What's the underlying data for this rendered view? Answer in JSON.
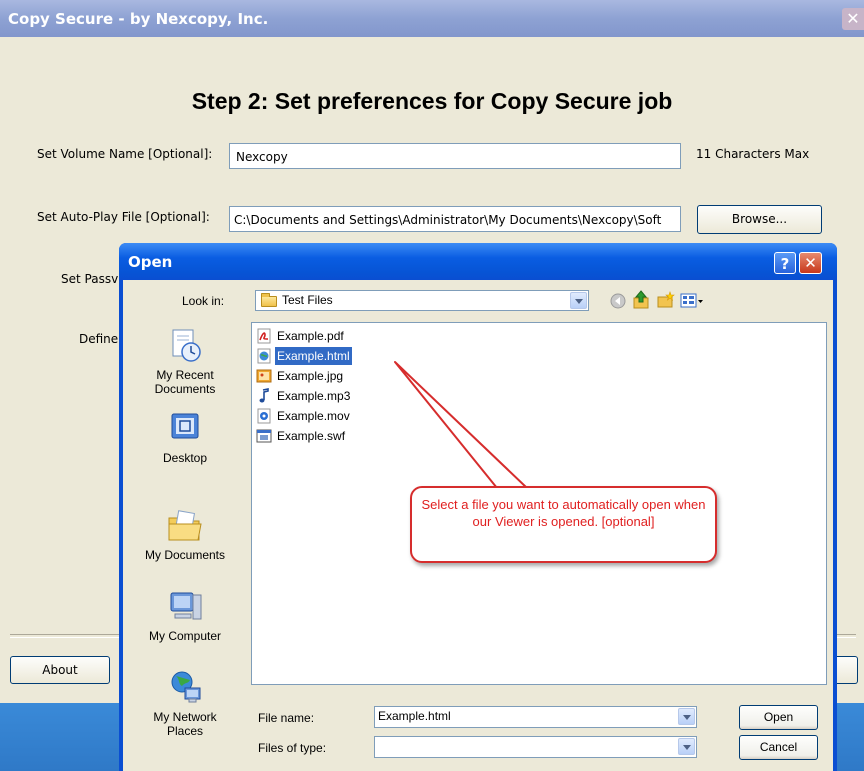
{
  "main_window": {
    "title": "Copy Secure - by Nexcopy, Inc.",
    "close_icon": "close-icon",
    "heading": "Step 2: Set preferences for Copy Secure job",
    "volume_name": {
      "label": "Set Volume Name [Optional]:",
      "value": "Nexcopy",
      "hint": "11 Characters Max"
    },
    "autoplay": {
      "label": "Set Auto-Play File [Optional]:",
      "value": "C:\\Documents and Settings\\Administrator\\My Documents\\Nexcopy\\Soft",
      "browse_label": "Browse..."
    },
    "password": {
      "label_partial": "Set Passv"
    },
    "define": {
      "label_partial": "Define"
    },
    "about_label": "About"
  },
  "open_dialog": {
    "title": "Open",
    "help_label": "?",
    "close_icon": "close-icon",
    "look_in": {
      "label": "Look in:",
      "value": "Test Files",
      "icon": "folder-icon"
    },
    "toolbar": [
      "back-icon",
      "up-folder-icon",
      "new-folder-icon",
      "view-menu-icon"
    ],
    "places": [
      {
        "label": "My Recent Documents",
        "icon": "recent-documents-icon"
      },
      {
        "label": "Desktop",
        "icon": "desktop-icon"
      },
      {
        "label": "My Documents",
        "icon": "my-documents-icon"
      },
      {
        "label": "My Computer",
        "icon": "my-computer-icon"
      },
      {
        "label": "My Network Places",
        "icon": "network-places-icon"
      }
    ],
    "files": [
      {
        "name": "Example.pdf",
        "icon": "pdf-file-icon",
        "selected": false
      },
      {
        "name": "Example.html",
        "icon": "html-file-icon",
        "selected": true
      },
      {
        "name": "Example.jpg",
        "icon": "image-file-icon",
        "selected": false
      },
      {
        "name": "Example.mp3",
        "icon": "audio-file-icon",
        "selected": false
      },
      {
        "name": "Example.mov",
        "icon": "video-file-icon",
        "selected": false
      },
      {
        "name": "Example.swf",
        "icon": "flash-file-icon",
        "selected": false
      }
    ],
    "callout": "Select a file you want to automatically open when our Viewer is opened. [optional]",
    "file_name": {
      "label": "File name:",
      "value": "Example.html"
    },
    "files_of_type": {
      "label": "Files of type:",
      "value": ""
    },
    "open_label": "Open",
    "cancel_label": "Cancel"
  },
  "colors": {
    "xp_blue": "#0a4ed2",
    "selection": "#316ac5",
    "callout_red": "#d62d2d",
    "dialog_bg": "#ece9d8"
  }
}
